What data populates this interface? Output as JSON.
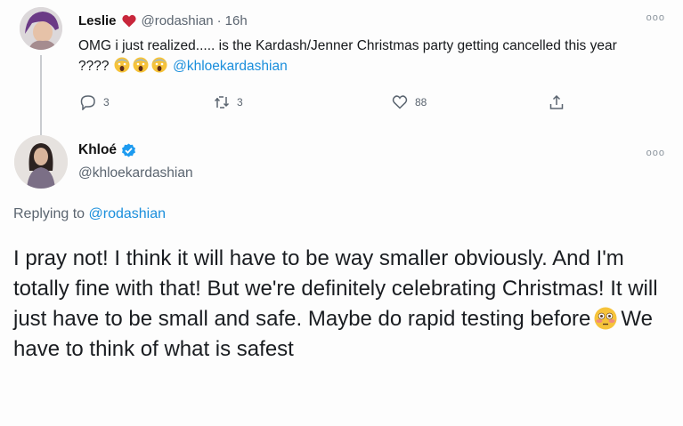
{
  "tweet_parent": {
    "name": "Leslie",
    "handle": "@rodashian",
    "separator": "·",
    "time": "16h",
    "text_before": "OMG i just realized..... is the Kardash/Jenner Christmas party getting cancelled this year ????",
    "mention": "@khloekardashian",
    "replies": "3",
    "retweets": "3",
    "likes": "88",
    "more": "ooo"
  },
  "tweet_reply": {
    "name": "Khloé",
    "handle": "@khloekardashian",
    "more": "ooo",
    "replying_label": "Replying to",
    "replying_mention": "@rodashian",
    "text_before_emoji": "I pray not! I think it will have to be way smaller obviously. And I'm totally fine with that! But we're definitely celebrating Christmas! It will just have to be small and safe. Maybe do rapid testing before",
    "text_after_emoji": "We have to think of what is safest"
  },
  "colors": {
    "link": "#1b8fdc",
    "verified": "#1d9bf0",
    "heart": "#c8263b",
    "secondary_text": "#5b6570"
  },
  "icons": {
    "heart": "heart-icon",
    "verified": "verified-badge-icon",
    "reply": "reply-icon",
    "retweet": "retweet-icon",
    "like": "like-icon",
    "share": "share-icon",
    "scream_emoji": "face-screaming-in-fear-emoji",
    "flushed_emoji": "flushed-face-emoji"
  }
}
